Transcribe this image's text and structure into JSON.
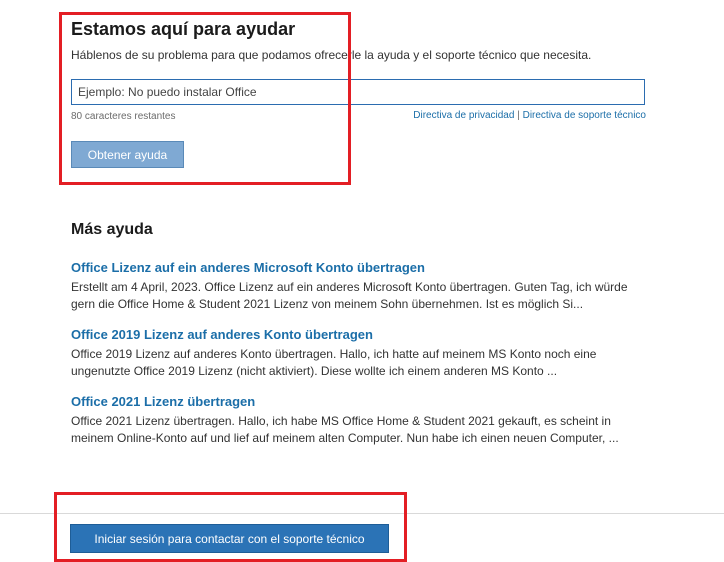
{
  "help": {
    "title": "Estamos aquí para ayudar",
    "subtitle": "Háblenos de su problema para que podamos ofrecerle la ayuda y el soporte técnico que necesita.",
    "input_placeholder": "Ejemplo: No puedo instalar Office",
    "chars_left": "80 caracteres restantes",
    "privacy_link": "Directiva de privacidad",
    "separator": "|",
    "support_policy_link": "Directiva de soporte técnico",
    "button_label": "Obtener ayuda"
  },
  "more_help": {
    "title": "Más ayuda",
    "articles": [
      {
        "title": "Office Lizenz auf ein anderes Microsoft Konto übertragen",
        "snippet": "Erstellt am 4 April, 2023. Office Lizenz auf ein anderes Microsoft Konto übertragen. Guten Tag, ich würde gern die Office Home & Student 2021 Lizenz von meinem Sohn übernehmen. Ist es möglich Si..."
      },
      {
        "title": "Office 2019 Lizenz auf anderes Konto übertragen",
        "snippet": "Office 2019 Lizenz auf anderes Konto übertragen. Hallo, ich hatte auf meinem MS Konto noch eine ungenutzte Office 2019 Lizenz (nicht aktiviert). Diese wollte ich einem anderen MS Konto ..."
      },
      {
        "title": "Office 2021 Lizenz übertragen",
        "snippet": "Office 2021 Lizenz übertragen. Hallo, ich habe MS Office Home & Student 2021 gekauft, es scheint in meinem Online-Konto auf und lief auf meinem alten Computer. Nun habe ich einen neuen Computer, ..."
      }
    ]
  },
  "footer": {
    "signin_button": "Iniciar sesión para contactar con el soporte técnico"
  },
  "colors": {
    "link": "#1b6ea8",
    "primary_button": "#2b73b6",
    "disabled_button": "#7fa9d3",
    "highlight": "#e31e24"
  }
}
